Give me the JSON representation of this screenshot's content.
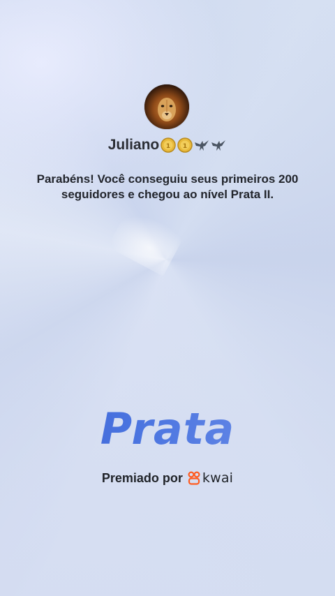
{
  "user": {
    "name": "Juliano",
    "badges": [
      "gold-coin-icon",
      "gold-coin-icon",
      "eagle-icon",
      "eagle-icon"
    ]
  },
  "message": "Parabéns! Você conseguiu seus primeiros 200 seguidores e chegou ao nível Prata II.",
  "tier": "Prata",
  "award": {
    "label": "Premiado por",
    "brand": "kwai",
    "brand_color": "#ff5a1f"
  },
  "colors": {
    "tier_gradient_start": "#3b5fd1",
    "tier_gradient_end": "#5d82e4",
    "text": "#22252c"
  }
}
